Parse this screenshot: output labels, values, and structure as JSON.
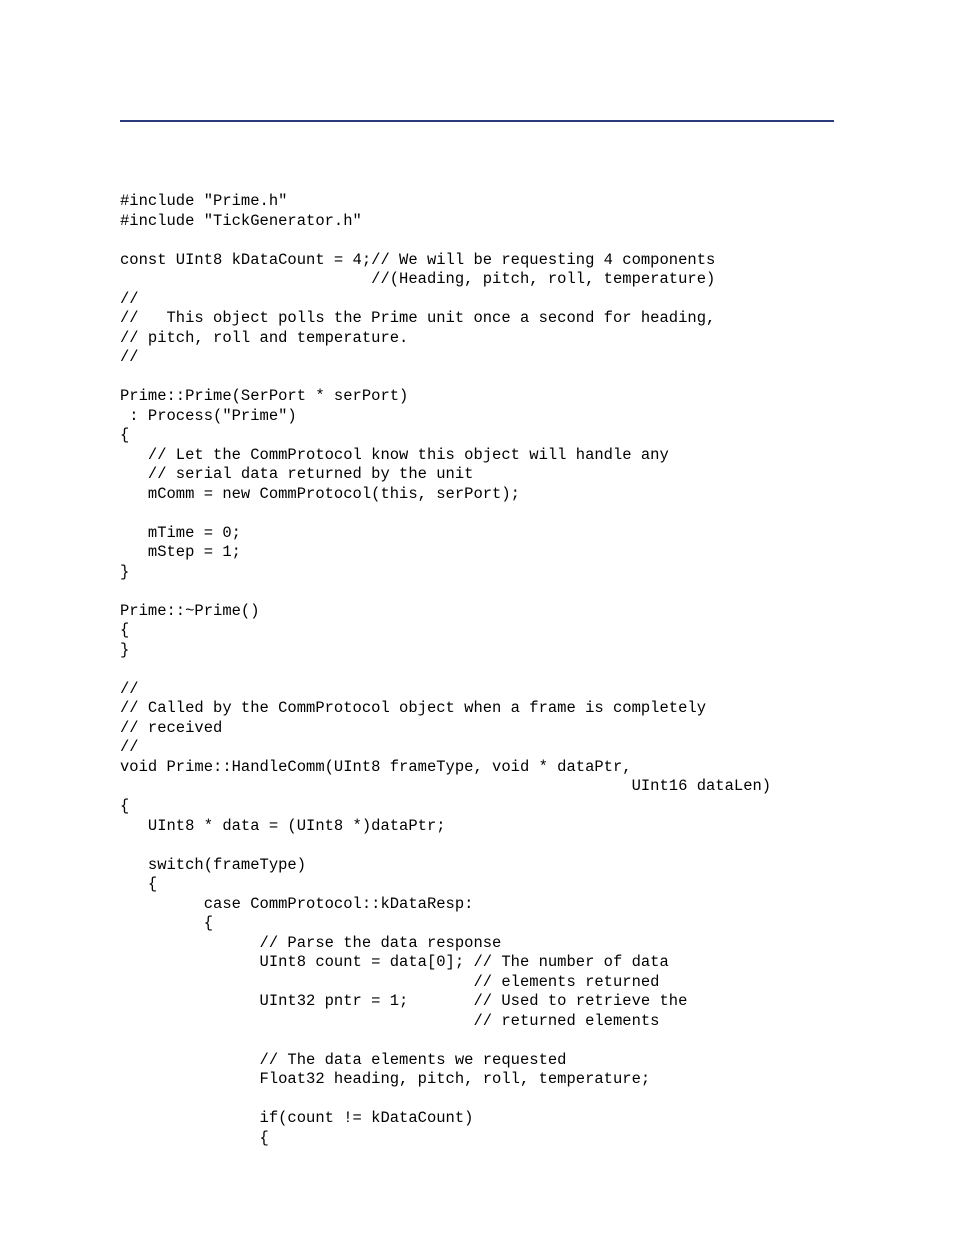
{
  "code": {
    "lines": [
      "#include \"Prime.h\"",
      "#include \"TickGenerator.h\"",
      "",
      "const UInt8 kDataCount = 4;// We will be requesting 4 components",
      "                           //(Heading, pitch, roll, temperature)",
      "//",
      "//   This object polls the Prime unit once a second for heading,",
      "// pitch, roll and temperature.",
      "//",
      "",
      "Prime::Prime(SerPort * serPort)",
      " : Process(\"Prime\")",
      "{",
      "   // Let the CommProtocol know this object will handle any",
      "   // serial data returned by the unit",
      "   mComm = new CommProtocol(this, serPort);",
      "",
      "   mTime = 0;",
      "   mStep = 1;",
      "}",
      "",
      "Prime::~Prime()",
      "{",
      "}",
      "",
      "//",
      "// Called by the CommProtocol object when a frame is completely",
      "// received",
      "//",
      "void Prime::HandleComm(UInt8 frameType, void * dataPtr,",
      "                                                       UInt16 dataLen)",
      "{",
      "   UInt8 * data = (UInt8 *)dataPtr;",
      "",
      "   switch(frameType)",
      "   {",
      "         case CommProtocol::kDataResp:",
      "         {",
      "               // Parse the data response",
      "               UInt8 count = data[0]; // The number of data",
      "                                      // elements returned",
      "               UInt32 pntr = 1;       // Used to retrieve the",
      "                                      // returned elements",
      "",
      "               // The data elements we requested",
      "               Float32 heading, pitch, roll, temperature;",
      "",
      "               if(count != kDataCount)",
      "               {"
    ]
  }
}
